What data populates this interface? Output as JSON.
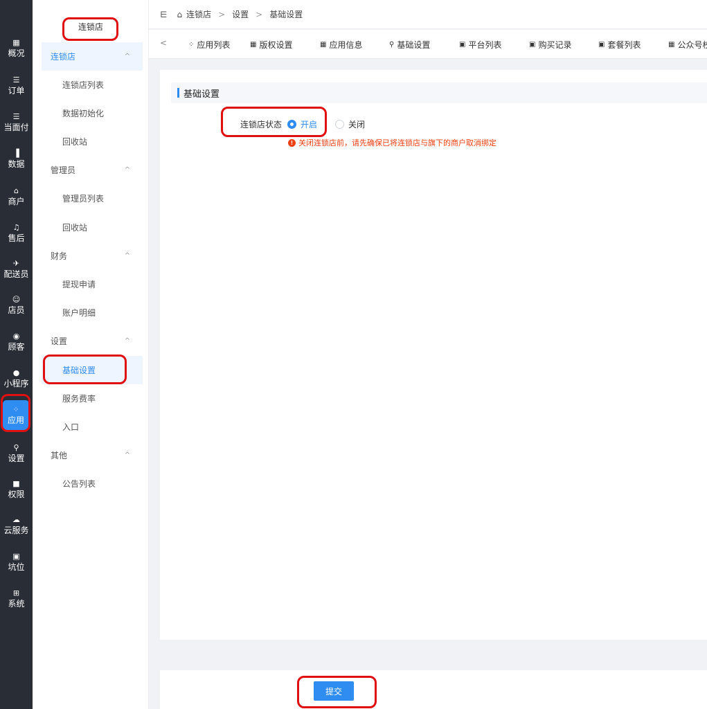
{
  "rail": [
    {
      "icon": "▦",
      "label": "概况"
    },
    {
      "icon": "☰",
      "label": "订单"
    },
    {
      "icon": "☰",
      "label": "当面付"
    },
    {
      "icon": "▐",
      "label": "数据"
    },
    {
      "icon": "⌂",
      "label": "商户"
    },
    {
      "icon": "♫",
      "label": "售后"
    },
    {
      "icon": "✈",
      "label": "配送员"
    },
    {
      "icon": "☺",
      "label": "店员"
    },
    {
      "icon": "◉",
      "label": "顾客"
    },
    {
      "icon": "●",
      "label": "小程序"
    },
    {
      "icon": "⁘",
      "label": "应用"
    },
    {
      "icon": "⚲",
      "label": "设置"
    },
    {
      "icon": "■",
      "label": "权限"
    },
    {
      "icon": "☁",
      "label": "云服务"
    },
    {
      "icon": "▣",
      "label": "坑位"
    },
    {
      "icon": "⊞",
      "label": "系统"
    }
  ],
  "sidebar": {
    "title": "连锁店",
    "items": [
      {
        "label": "连锁店",
        "type": "group",
        "chevron": "^"
      },
      {
        "label": "连锁店列表",
        "type": "sub"
      },
      {
        "label": "数据初始化",
        "type": "sub"
      },
      {
        "label": "回收站",
        "type": "sub"
      },
      {
        "label": "管理员",
        "type": "group",
        "chevron": "^"
      },
      {
        "label": "管理员列表",
        "type": "sub"
      },
      {
        "label": "回收站",
        "type": "sub"
      },
      {
        "label": "财务",
        "type": "group",
        "chevron": "^"
      },
      {
        "label": "提现申请",
        "type": "sub"
      },
      {
        "label": "账户明细",
        "type": "sub"
      },
      {
        "label": "设置",
        "type": "group",
        "chevron": "^"
      },
      {
        "label": "基础设置",
        "type": "sub"
      },
      {
        "label": "服务费率",
        "type": "sub"
      },
      {
        "label": "入口",
        "type": "sub"
      },
      {
        "label": "其他",
        "type": "group",
        "chevron": "^"
      },
      {
        "label": "公告列表",
        "type": "sub"
      }
    ]
  },
  "breadcrumb": {
    "collapse_icon": "⋿",
    "home_icon": "⌂",
    "items": [
      "连锁店",
      ">",
      "设置",
      ">",
      "基础设置"
    ]
  },
  "tabs": {
    "back": "<",
    "items": [
      {
        "icon": "⁘",
        "label": "应用列表"
      },
      {
        "icon": "▦",
        "label": "版权设置"
      },
      {
        "icon": "▦",
        "label": "应用信息"
      },
      {
        "icon": "⚲",
        "label": "基础设置"
      },
      {
        "icon": "▣",
        "label": "平台列表"
      },
      {
        "icon": "▣",
        "label": "购买记录"
      },
      {
        "icon": "▣",
        "label": "套餐列表"
      },
      {
        "icon": "▦",
        "label": "公众号校"
      }
    ]
  },
  "form": {
    "section_title": "基础设置",
    "status_label": "连锁店状态",
    "options": [
      "开启",
      "关闭"
    ],
    "selected": "开启",
    "warning_icon": "!",
    "warning": "关闭连锁店前，请先确保已将连锁店与旗下的商户取消绑定"
  },
  "footer": {
    "submit": "提交"
  },
  "colors": {
    "accent": "#2f8cf0",
    "rail_bg": "#282d36",
    "warning": "#ed4014",
    "annotation": "#e01010"
  }
}
